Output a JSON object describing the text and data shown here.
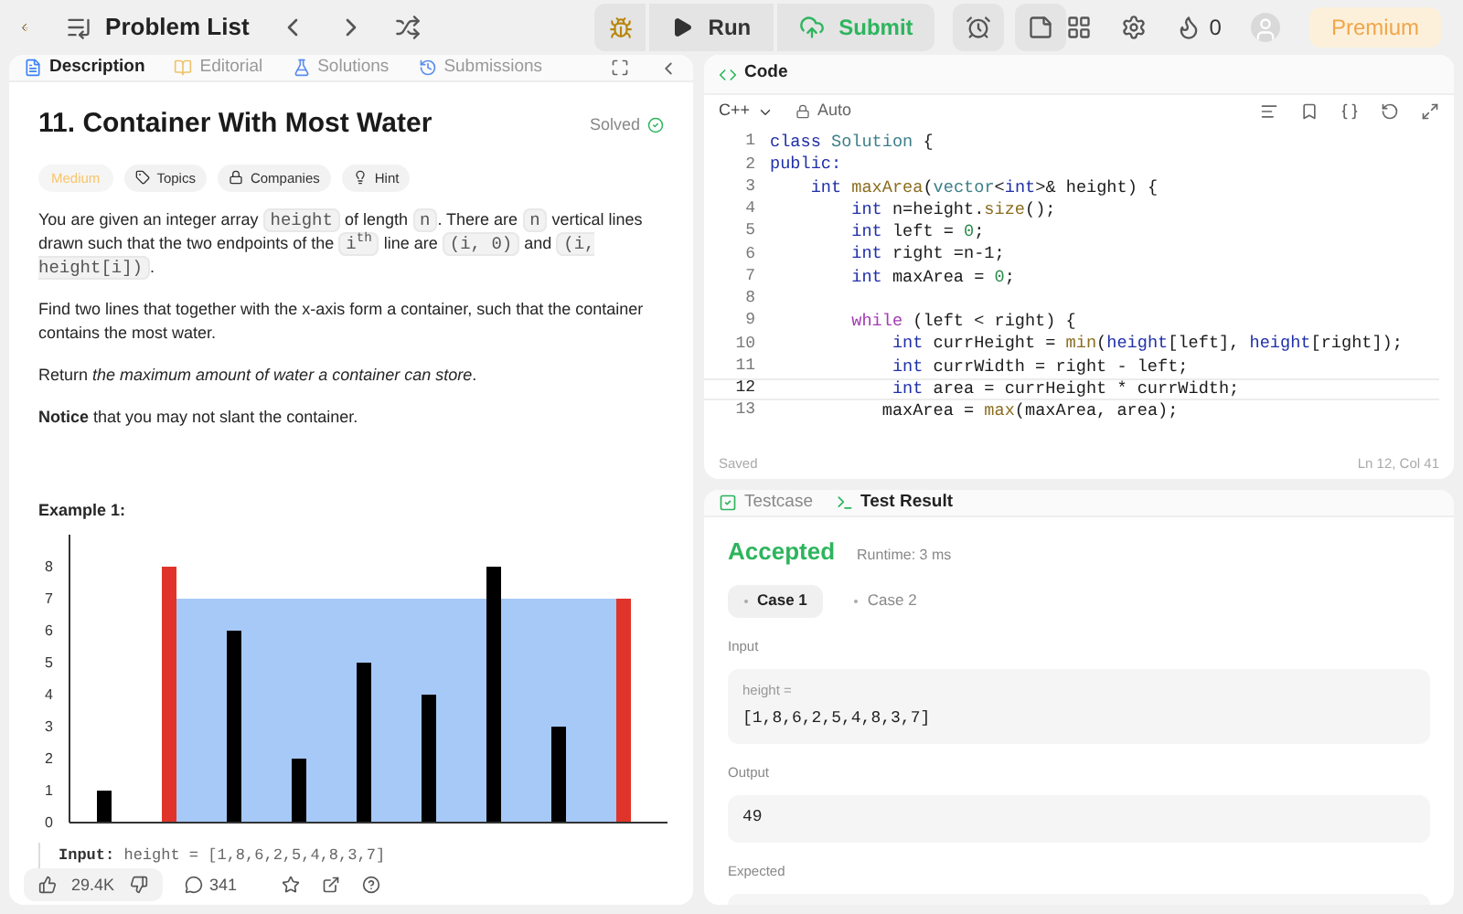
{
  "topbar": {
    "title": "Problem List",
    "run": "Run",
    "submit": "Submit",
    "streak": "0",
    "premium": "Premium"
  },
  "description_panel": {
    "tabs": [
      {
        "label": "Description",
        "selected": true
      },
      {
        "label": "Editorial",
        "selected": false
      },
      {
        "label": "Solutions",
        "selected": false
      },
      {
        "label": "Submissions",
        "selected": false
      }
    ],
    "title": "11. Container With Most Water",
    "status": "Solved",
    "tags": [
      {
        "kind": "difficulty",
        "label": "Medium"
      },
      {
        "kind": "topics",
        "label": "Topics"
      },
      {
        "kind": "companies",
        "label": "Companies"
      },
      {
        "kind": "hint",
        "label": "Hint"
      }
    ],
    "paragraphs": [
      [
        {
          "kind": "text",
          "text": "You are given an integer array "
        },
        {
          "kind": "code",
          "text": "height"
        },
        {
          "kind": "text",
          "text": " of length "
        },
        {
          "kind": "code",
          "text": "n"
        },
        {
          "kind": "text",
          "text": ". There are "
        },
        {
          "kind": "code",
          "text": "n"
        },
        {
          "kind": "text",
          "text": " vertical lines drawn such that the two endpoints of the "
        },
        {
          "kind": "code",
          "text": "i$^{th}$"
        },
        {
          "kind": "text",
          "text": " line are "
        },
        {
          "kind": "code",
          "text": "(i, 0)"
        },
        {
          "kind": "text",
          "text": " and "
        },
        {
          "kind": "code",
          "text": "(i, height[i])"
        },
        {
          "kind": "text",
          "text": "."
        }
      ],
      [
        {
          "kind": "text",
          "text": "Find two lines that together with the x-axis form a container, such that the container contains the most water."
        }
      ],
      [
        {
          "kind": "text",
          "text": "Return "
        },
        {
          "kind": "em",
          "text": "the maximum amount of water a container can store"
        },
        {
          "kind": "text",
          "text": "."
        }
      ],
      [
        {
          "kind": "bold",
          "text": "Notice"
        },
        {
          "kind": "text",
          "text": " that you may not slant the container."
        }
      ]
    ],
    "example_title": "Example 1:",
    "chart_data": {
      "type": "bar",
      "stacked": true,
      "series": [
        {
          "color": "#000000",
          "values": [
            1,
            null,
            6,
            2,
            5,
            4,
            8,
            3,
            null
          ]
        },
        {
          "color": "#e0342a",
          "values": [
            null,
            8,
            null,
            null,
            null,
            null,
            null,
            null,
            7
          ]
        }
      ],
      "yticks": [
        0,
        1,
        2,
        3,
        4,
        5,
        6,
        7,
        8
      ],
      "ylim": [
        0,
        9
      ]
    },
    "example_input_label": "Input:",
    "example_input": "height = [1,8,6,2,5,4,8,3,7]",
    "footer": {
      "likes": "29.4K",
      "comments": "341"
    }
  },
  "code_panel": {
    "title": "Code",
    "language": "C++",
    "mode": "Auto",
    "lines": [
      {
        "number": "1",
        "selected": false,
        "tokens": [
          {
            "kind": "kw",
            "text": "class"
          },
          {
            "kind": "cls",
            "text": " Solution"
          },
          {
            "kind": "p",
            "text": " {"
          }
        ]
      },
      {
        "number": "2",
        "selected": false,
        "tokens": [
          {
            "kind": "kw",
            "text": "public:"
          }
        ]
      },
      {
        "number": "3",
        "selected": false,
        "tokens": [
          {
            "kind": "kw",
            "text": "    int"
          },
          {
            "kind": "fn",
            "text": " maxArea"
          },
          {
            "kind": "p",
            "text": "("
          },
          {
            "kind": "cls",
            "text": "vector"
          },
          {
            "kind": "p",
            "text": "<"
          },
          {
            "kind": "kw",
            "text": "int"
          },
          {
            "kind": "p",
            "text": ">& height) {"
          }
        ]
      },
      {
        "number": "4",
        "selected": false,
        "tokens": [
          {
            "kind": "kw",
            "text": "        int"
          },
          {
            "kind": "p",
            "text": " n=height."
          },
          {
            "kind": "fn",
            "text": "size"
          },
          {
            "kind": "p",
            "text": "();"
          }
        ]
      },
      {
        "number": "5",
        "selected": false,
        "tokens": [
          {
            "kind": "kw",
            "text": "        int"
          },
          {
            "kind": "p",
            "text": " left = "
          },
          {
            "kind": "num",
            "text": "0"
          },
          {
            "kind": "p",
            "text": ";"
          }
        ]
      },
      {
        "number": "6",
        "selected": false,
        "tokens": [
          {
            "kind": "kw",
            "text": "        int"
          },
          {
            "kind": "p",
            "text": " right =n-1;"
          }
        ]
      },
      {
        "number": "7",
        "selected": false,
        "tokens": [
          {
            "kind": "kw",
            "text": "        int"
          },
          {
            "kind": "p",
            "text": " maxArea = "
          },
          {
            "kind": "num",
            "text": "0"
          },
          {
            "kind": "p",
            "text": ";"
          }
        ]
      },
      {
        "number": "8",
        "selected": false
      },
      {
        "number": "9",
        "selected": false,
        "tokens": [
          {
            "kind": "ctl",
            "text": "        while"
          },
          {
            "kind": "p",
            "text": " (left < right) {"
          }
        ]
      },
      {
        "number": "10",
        "selected": false,
        "tokens": [
          {
            "kind": "kw",
            "text": "            int"
          },
          {
            "kind": "p",
            "text": " currHeight = "
          },
          {
            "kind": "fn",
            "text": "min"
          },
          {
            "kind": "p",
            "text": "("
          },
          {
            "kind": "kw",
            "text": "height"
          },
          {
            "kind": "p",
            "text": "[left], "
          },
          {
            "kind": "kw",
            "text": "height"
          },
          {
            "kind": "p",
            "text": "[right]);"
          }
        ]
      },
      {
        "number": "11",
        "selected": false,
        "tokens": [
          {
            "kind": "kw",
            "text": "            int"
          },
          {
            "kind": "p",
            "text": " currWidth = right - left;"
          }
        ]
      },
      {
        "number": "12",
        "selected": true,
        "tokens": [
          {
            "kind": "kw",
            "text": "            int"
          },
          {
            "kind": "p",
            "text": " area = currHeight * currWidth;"
          }
        ]
      },
      {
        "number": "13",
        "selected": false,
        "tokens": [
          {
            "kind": "p",
            "text": "           maxArea = "
          },
          {
            "kind": "fn",
            "text": "max"
          },
          {
            "kind": "p",
            "text": "(maxArea, area);"
          }
        ]
      }
    ],
    "saved": "Saved",
    "cursor": "Ln 12, Col 41"
  },
  "result_panel": {
    "tabs": [
      {
        "label": "Testcase",
        "selected": false
      },
      {
        "label": "Test Result",
        "selected": true
      }
    ],
    "verdict": "Accepted",
    "runtime": "Runtime: 3 ms",
    "cases": [
      {
        "label": "Case 1",
        "selected": true
      },
      {
        "label": "Case 2",
        "selected": false
      }
    ],
    "sections": [
      {
        "label": "Input",
        "var": "height =",
        "value": "[1,8,6,2,5,4,8,3,7]"
      },
      {
        "label": "Output",
        "value": "49"
      },
      {
        "label": "Expected"
      }
    ]
  }
}
